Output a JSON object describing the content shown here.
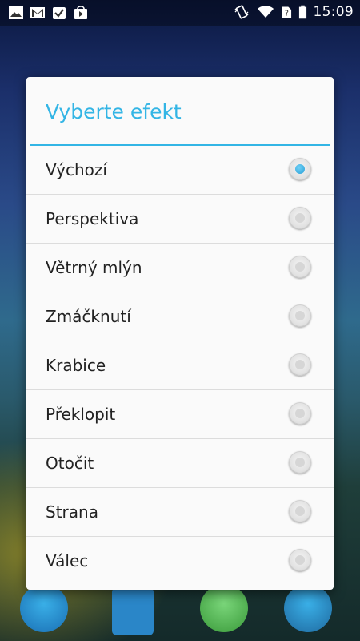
{
  "status_bar": {
    "time": "15:09",
    "left_icons": [
      "gallery-icon",
      "gmail-icon",
      "task-icon",
      "play-store-icon"
    ],
    "right_icons": [
      "vibrate-icon",
      "wifi-icon",
      "no-sim-icon",
      "battery-icon"
    ]
  },
  "dialog": {
    "title": "Vyberte efekt",
    "accent_color": "#33b5e5",
    "options": [
      {
        "label": "Výchozí",
        "checked": true
      },
      {
        "label": "Perspektiva",
        "checked": false
      },
      {
        "label": "Větrný mlýn",
        "checked": false
      },
      {
        "label": "Zmáčknutí",
        "checked": false
      },
      {
        "label": "Krabice",
        "checked": false
      },
      {
        "label": "Překlopit",
        "checked": false
      },
      {
        "label": "Otočit",
        "checked": false
      },
      {
        "label": "Strana",
        "checked": false
      },
      {
        "label": "Válec",
        "checked": false
      }
    ]
  },
  "dock": {
    "icons": [
      "phone-icon",
      "contacts-icon",
      "messaging-icon",
      "browser-icon"
    ]
  }
}
